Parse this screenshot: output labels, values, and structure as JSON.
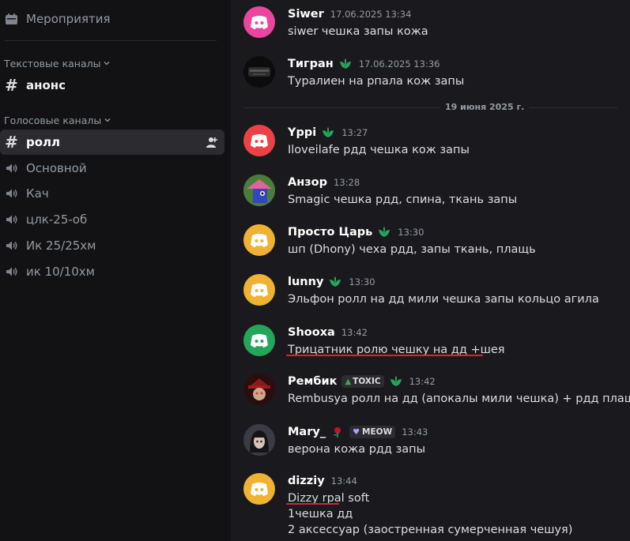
{
  "sidebar": {
    "events_label": "Мероприятия",
    "text_category": "Текстовые каналы",
    "voice_category": "Голосовые каналы",
    "text_channels": [
      {
        "label": "анонс"
      }
    ],
    "voice_channels": [
      {
        "label": "ролл"
      },
      {
        "label": "Основной"
      },
      {
        "label": "Кач"
      },
      {
        "label": "цлк-25-об"
      },
      {
        "label": "Ик 25/25хм"
      },
      {
        "label": "ик 10/10хм"
      }
    ]
  },
  "date_divider": "19 июня 2025 г.",
  "messages": [
    {
      "user": "Siwer",
      "time": "17.06.2025 13:34",
      "lines": [
        "siwer чешка запы кожа"
      ],
      "avatar_color": "#eb459e"
    },
    {
      "user": "Тигран",
      "time": "17.06.2025 13:36",
      "lines": [
        "Туралиен на рпала кож запы"
      ]
    },
    {
      "user": "Yppi",
      "time": "13:27",
      "lines": [
        "Iloveilafe рдд чешка кож запы"
      ],
      "avatar_color": "#ed4245"
    },
    {
      "user": "Анзор",
      "time": "13:28",
      "lines": [
        "Smagic чешка рдд, спина, ткань запы"
      ]
    },
    {
      "user": "Просто Царь",
      "time": "13:30",
      "lines": [
        "шп (Dhony) чеха рдд, запы ткань, плащь"
      ],
      "avatar_color": "#f0b232"
    },
    {
      "user": "lunny",
      "time": "13:30",
      "lines": [
        "Эльфон ролл на дд мили чешка запы кольцо агила"
      ],
      "avatar_color": "#f0b232"
    },
    {
      "user": "Shooxa",
      "time": "13:42",
      "lines": [
        "Трицатник ролю чешку на дд +шея"
      ],
      "avatar_color": "#23a55a"
    },
    {
      "user": "Рембик",
      "time": "13:42",
      "tag": "TOXIC",
      "lines": [
        "Rembusya ролл на дд (апокалы мили чешка) + рдд плащь"
      ]
    },
    {
      "user": "Mary_",
      "time": "13:43",
      "tag": "MEOW",
      "lines": [
        "верона кожа рдд запы"
      ]
    },
    {
      "user": "dizziy",
      "time": "13:44",
      "lines": [
        "Dizzy rpal soft",
        "1чешка дд",
        "2 аксессуар (заостренная сумерченная чешуя)"
      ],
      "avatar_color": "#f0b232"
    }
  ],
  "colors": {
    "sidebar_bg": "#121214",
    "main_bg": "#1a1a1e",
    "underline": "#e3202b",
    "leaf": "#23a55a"
  }
}
